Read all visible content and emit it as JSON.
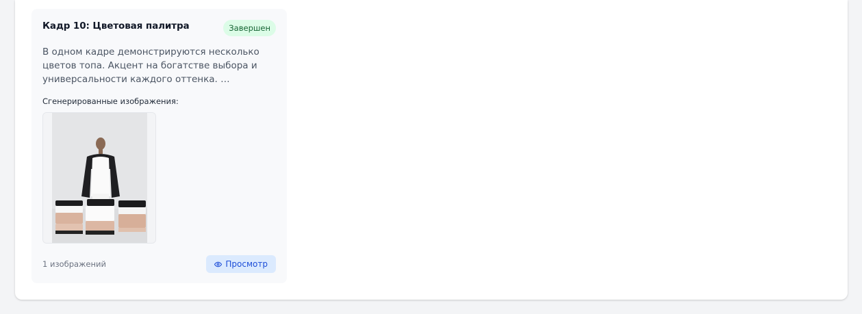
{
  "card": {
    "title": "Кадр 10: Цветовая палитра",
    "status": "Завершен",
    "description": "В одном кадре демонстрируются несколько цветов топа. Акцент на богатстве выбора и универсальности каждого оттенка. …",
    "images_label": "Сгенерированные изображения:",
    "image_count": "1 изображений",
    "view_label": "Просмотр",
    "view_icon": "eye-icon",
    "thumbnail": "generated-image-thumbnail"
  },
  "colors": {
    "status_bg": "#dcfce7",
    "status_text": "#166534",
    "button_bg": "#dbeafe",
    "button_text": "#1d4ed8"
  }
}
